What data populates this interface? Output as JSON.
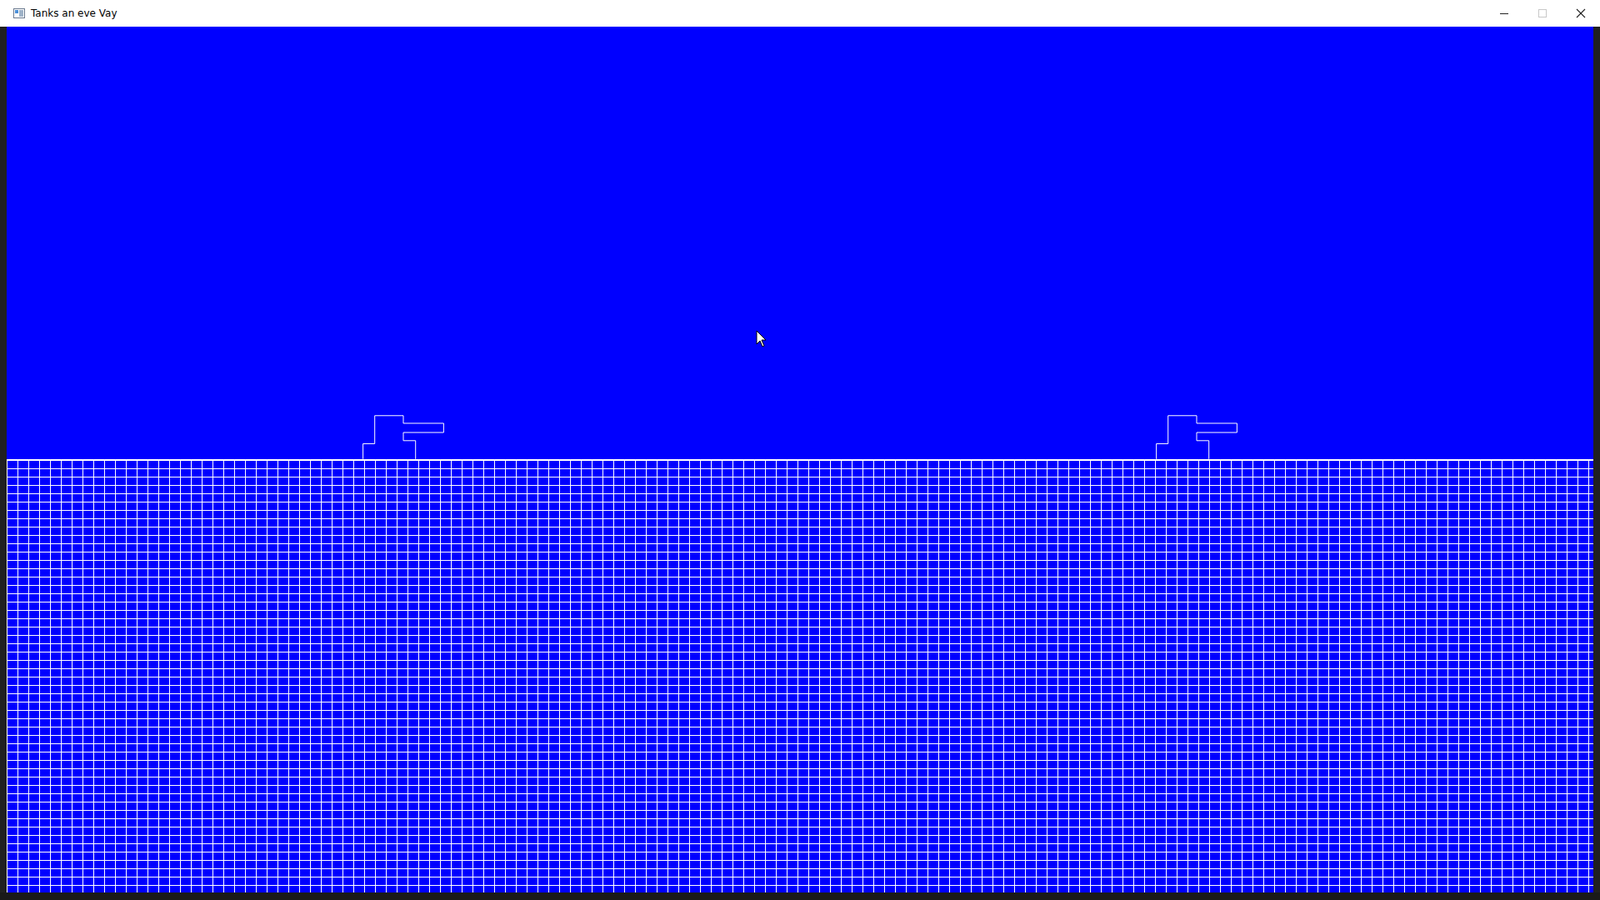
{
  "window": {
    "title": "Tanks an eve Vay",
    "maximize_disabled": true
  },
  "tanks": [
    {
      "facing": "right"
    },
    {
      "facing": "right"
    }
  ]
}
